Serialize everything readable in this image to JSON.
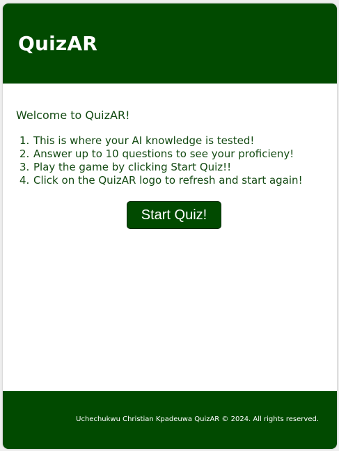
{
  "header": {
    "logo_text": "QuizAR"
  },
  "main": {
    "welcome": "Welcome to QuizAR!",
    "rules": [
      {
        "number": "1.",
        "text": "This is where your AI knowledge is tested!"
      },
      {
        "number": "2.",
        "text": "Answer up to 10 questions to see your proficieny!"
      },
      {
        "number": "3.",
        "text": "Play the game by clicking Start Quiz!!"
      },
      {
        "number": "4.",
        "text": "Click on the QuizAR logo to refresh and start again!"
      }
    ],
    "start_button_label": "Start Quiz!"
  },
  "footer": {
    "text": "Uchechukwu Christian Kpadeuwa QuizAR © 2024. All rights reserved."
  },
  "colors": {
    "brand_green": "#014a00",
    "text_green": "#134a12",
    "background": "#ffffff"
  }
}
